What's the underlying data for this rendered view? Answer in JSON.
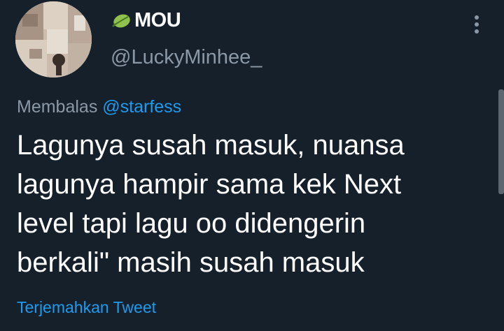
{
  "author": {
    "display_name": "MOU",
    "handle": "@LuckyMinhee_",
    "name_emoji": "leaf-icon",
    "avatar": "profile-photo"
  },
  "reply": {
    "prefix": "Membalas",
    "mention": "@starfess"
  },
  "tweet": {
    "lines": [
      "Lagunya susah masuk, nuansa",
      "lagunya hampir sama kek Next",
      "level tapi lagu oo didengerin",
      "berkali\" masih susah masuk"
    ],
    "translate_label": "Terjemahkan Tweet"
  },
  "colors": {
    "background": "#15202b",
    "text": "#ffffff",
    "secondary": "#8b98a5",
    "accent": "#1d9bf0"
  },
  "icons": {
    "more": "more-vertical-icon"
  }
}
